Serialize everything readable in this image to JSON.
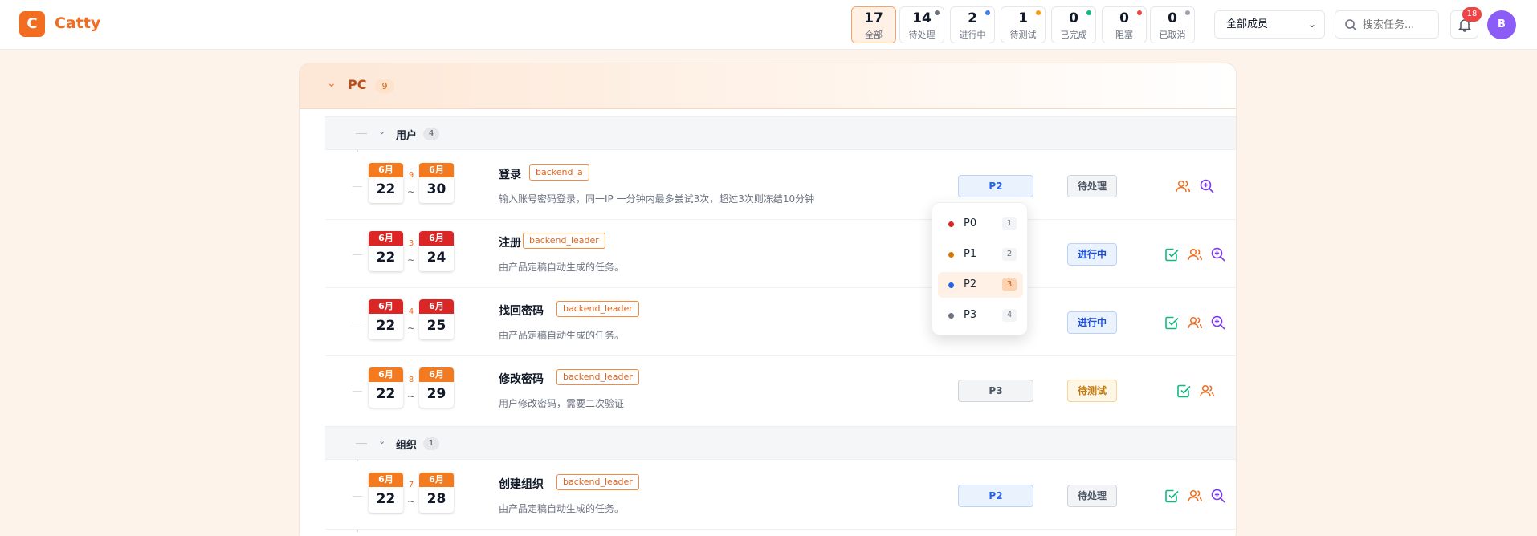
{
  "app": {
    "logo_letter": "C",
    "name": "Catty"
  },
  "stats": [
    {
      "count": "17",
      "label": "全部",
      "dot": ""
    },
    {
      "count": "14",
      "label": "待处理",
      "dot": "#6b7280"
    },
    {
      "count": "2",
      "label": "进行中",
      "dot": "#3b82f6"
    },
    {
      "count": "1",
      "label": "待测试",
      "dot": "#f59e0b"
    },
    {
      "count": "0",
      "label": "已完成",
      "dot": "#10b981"
    },
    {
      "count": "0",
      "label": "阻塞",
      "dot": "#ef4444"
    },
    {
      "count": "0",
      "label": "已取消",
      "dot": "#9ca3af"
    }
  ],
  "filters": {
    "member_select": "全部成员",
    "search_placeholder": "搜索任务...",
    "notification_count": "18",
    "avatar_initial": "B"
  },
  "group": {
    "name": "PC",
    "count": "9",
    "subgroups": [
      {
        "name": "用户",
        "count": "4",
        "tasks": [
          {
            "start_month": "6月",
            "start_day": "22",
            "duration": "9",
            "end_month": "6月",
            "end_day": "30",
            "title": "登录",
            "tag": "backend_a",
            "desc": "输入账号密码登录，同一IP 一分钟内最多尝试3次，超过3次则冻结10分钟",
            "priority": "P2",
            "status": "待处理"
          },
          {
            "start_month": "6月",
            "start_day": "22",
            "duration": "3",
            "end_month": "6月",
            "end_day": "24",
            "title": "注册",
            "tag": "backend_leader",
            "desc": "由产品定稿自动生成的任务。",
            "priority": "",
            "status": "进行中"
          },
          {
            "start_month": "6月",
            "start_day": "22",
            "duration": "4",
            "end_month": "6月",
            "end_day": "25",
            "title": "找回密码",
            "tag": "backend_leader",
            "desc": "由产品定稿自动生成的任务。",
            "priority": "",
            "status": "进行中"
          },
          {
            "start_month": "6月",
            "start_day": "22",
            "duration": "8",
            "end_month": "6月",
            "end_day": "29",
            "title": "修改密码",
            "tag": "backend_leader",
            "desc": "用户修改密码，需要二次验证",
            "priority": "P3",
            "status": "待测试"
          }
        ]
      },
      {
        "name": "组织",
        "count": "1",
        "tasks": [
          {
            "start_month": "6月",
            "start_day": "22",
            "duration": "7",
            "end_month": "6月",
            "end_day": "28",
            "title": "创建组织",
            "tag": "backend_leader",
            "desc": "由产品定稿自动生成的任务。",
            "priority": "P2",
            "status": "待处理"
          }
        ]
      }
    ]
  },
  "priority_dropdown": {
    "options": [
      {
        "label": "P0",
        "count": "1",
        "color": "#dc2626"
      },
      {
        "label": "P1",
        "count": "2",
        "color": "#d97706"
      },
      {
        "label": "P2",
        "count": "3",
        "color": "#2563eb"
      },
      {
        "label": "P3",
        "count": "4",
        "color": "#6b7280"
      }
    ],
    "selected": "P2"
  },
  "colors": {
    "accent": "#f26d1f",
    "brand_dark": "#b9501a",
    "avatar": "#8b5cf6",
    "badge": "#ef4444"
  }
}
